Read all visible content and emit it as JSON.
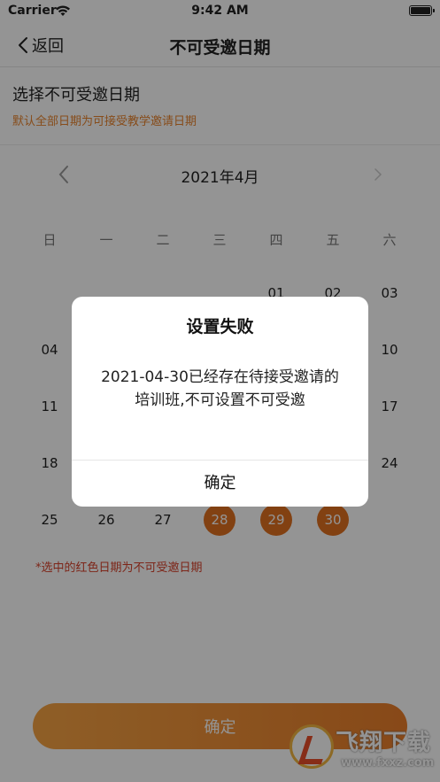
{
  "status_bar": {
    "carrier": "Carrier",
    "time": "9:42 AM"
  },
  "nav": {
    "back_label": "返回",
    "title": "不可受邀日期"
  },
  "section": {
    "title": "选择不可受邀日期",
    "subtitle": "默认全部日期为可接受教学邀请日期"
  },
  "calendar": {
    "month_label": "2021年4月",
    "weekdays": [
      "日",
      "一",
      "二",
      "三",
      "四",
      "五",
      "六"
    ],
    "visible_days": {
      "d01": "01",
      "d02": "02",
      "d03": "03",
      "d04": "04",
      "d10": "10",
      "d11": "11",
      "d17": "17",
      "d18": "18",
      "d24": "24",
      "d25": "25",
      "d26": "26",
      "d27": "27",
      "d28": "28",
      "d29": "29",
      "d30": "30"
    },
    "selected_days": [
      "28",
      "29",
      "30"
    ],
    "selected_color": "#e07020"
  },
  "hint": "*选中的红色日期为不可受邀日期",
  "confirm_button": "确定",
  "dialog": {
    "title": "设置失败",
    "message": "2021-04-30已经存在待接受邀请的培训班,不可设置不可受邀",
    "button": "确定"
  },
  "watermark": {
    "text": "飞翔下载",
    "url": "www.fxxz.com"
  },
  "colors": {
    "accent": "#ea7e2a",
    "hint_red": "#d7412a",
    "subtitle_orange": "#e8842e"
  }
}
